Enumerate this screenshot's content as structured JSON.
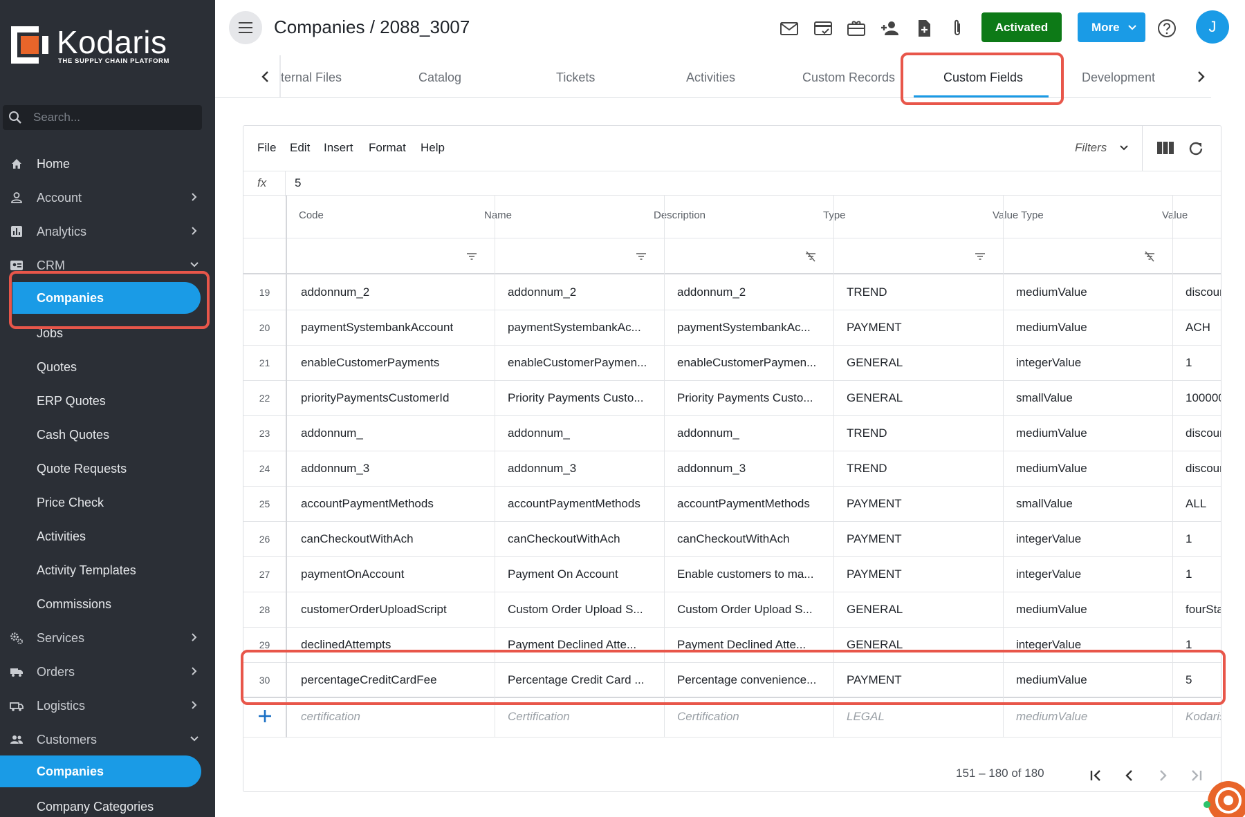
{
  "brand": {
    "name": "Kodaris",
    "tagline": "THE SUPPLY CHAIN PLATFORM",
    "accent": "#1a9be6",
    "sidebar_bg": "#2b2f36",
    "logo_orange": "#e8652a"
  },
  "search": {
    "placeholder": "Search..."
  },
  "sidebar": {
    "items": [
      {
        "label": "Home",
        "icon": "home-icon"
      },
      {
        "label": "Account",
        "icon": "person-icon"
      },
      {
        "label": "Analytics",
        "icon": "analytics-icon"
      },
      {
        "label": "CRM",
        "icon": "contact-card-icon"
      },
      {
        "label": "Companies"
      },
      {
        "label": "Jobs"
      },
      {
        "label": "Quotes"
      },
      {
        "label": "ERP Quotes"
      },
      {
        "label": "Cash Quotes"
      },
      {
        "label": "Quote Requests"
      },
      {
        "label": "Price Check"
      },
      {
        "label": "Activities"
      },
      {
        "label": "Activity Templates"
      },
      {
        "label": "Commissions"
      },
      {
        "label": "Services",
        "icon": "gears-icon"
      },
      {
        "label": "Orders",
        "icon": "truck-icon"
      },
      {
        "label": "Logistics",
        "icon": "logistics-icon"
      },
      {
        "label": "Customers",
        "icon": "people-icon"
      },
      {
        "label": "Companies"
      },
      {
        "label": "Company Categories"
      }
    ]
  },
  "header": {
    "title": "Companies / 2088_3007",
    "activated_label": "Activated",
    "more_label": "More",
    "avatar_initial": "J"
  },
  "tabs": {
    "items": [
      "ternal Files",
      "Catalog",
      "Tickets",
      "Activities",
      "Custom Records",
      "Custom Fields",
      "Development"
    ],
    "active": "Custom Fields"
  },
  "toolbar": {
    "menu": [
      "File",
      "Edit",
      "Insert",
      "Format",
      "Help"
    ],
    "filters_label": "Filters"
  },
  "formula": {
    "fx": "fx",
    "value": "5"
  },
  "grid": {
    "columns": [
      "Code",
      "Name",
      "Description",
      "Type",
      "Value Type",
      "Value"
    ],
    "rows": [
      {
        "n": "19",
        "code": "addonnum_2",
        "name": "addonnum_2",
        "desc": "addonnum_2",
        "type": "TREND",
        "vtype": "mediumValue",
        "value": "discoun"
      },
      {
        "n": "20",
        "code": "paymentSystembankAccount",
        "name": "paymentSystembankAc...",
        "desc": "paymentSystembankAc...",
        "type": "PAYMENT",
        "vtype": "mediumValue",
        "value": "ACH"
      },
      {
        "n": "21",
        "code": "enableCustomerPayments",
        "name": "enableCustomerPaymen...",
        "desc": "enableCustomerPaymen...",
        "type": "GENERAL",
        "vtype": "integerValue",
        "value": "1"
      },
      {
        "n": "22",
        "code": "priorityPaymentsCustomerId",
        "name": "Priority Payments Custo...",
        "desc": "Priority Payments Custo...",
        "type": "GENERAL",
        "vtype": "smallValue",
        "value": "100000"
      },
      {
        "n": "23",
        "code": "addonnum_",
        "name": "addonnum_",
        "desc": "addonnum_",
        "type": "TREND",
        "vtype": "mediumValue",
        "value": "discoun"
      },
      {
        "n": "24",
        "code": "addonnum_3",
        "name": "addonnum_3",
        "desc": "addonnum_3",
        "type": "TREND",
        "vtype": "mediumValue",
        "value": "discoun"
      },
      {
        "n": "25",
        "code": "accountPaymentMethods",
        "name": "accountPaymentMethods",
        "desc": "accountPaymentMethods",
        "type": "PAYMENT",
        "vtype": "smallValue",
        "value": "ALL"
      },
      {
        "n": "26",
        "code": "canCheckoutWithAch",
        "name": "canCheckoutWithAch",
        "desc": "canCheckoutWithAch",
        "type": "PAYMENT",
        "vtype": "integerValue",
        "value": "1"
      },
      {
        "n": "27",
        "code": "paymentOnAccount",
        "name": "Payment On Account",
        "desc": "Enable customers to ma...",
        "type": "PAYMENT",
        "vtype": "integerValue",
        "value": "1"
      },
      {
        "n": "28",
        "code": "customerOrderUploadScript",
        "name": "Custom Order Upload S...",
        "desc": "Custom Order Upload S...",
        "type": "GENERAL",
        "vtype": "mediumValue",
        "value": "fourSta"
      },
      {
        "n": "29",
        "code": "declinedAttempts",
        "name": "Payment Declined Atte...",
        "desc": "Payment Declined Atte...",
        "type": "GENERAL",
        "vtype": "integerValue",
        "value": "1"
      },
      {
        "n": "30",
        "code": "percentageCreditCardFee",
        "name": "Percentage Credit Card ...",
        "desc": "Percentage convenience...",
        "type": "PAYMENT",
        "vtype": "mediumValue",
        "value": "5"
      }
    ],
    "placeholder": {
      "code": "certification",
      "name": "Certification",
      "desc": "Certification",
      "type": "LEGAL",
      "vtype": "mediumValue",
      "value": "Kodaris"
    }
  },
  "pager": {
    "text": "151 – 180 of 180"
  },
  "highlight_color": "#e8564a"
}
